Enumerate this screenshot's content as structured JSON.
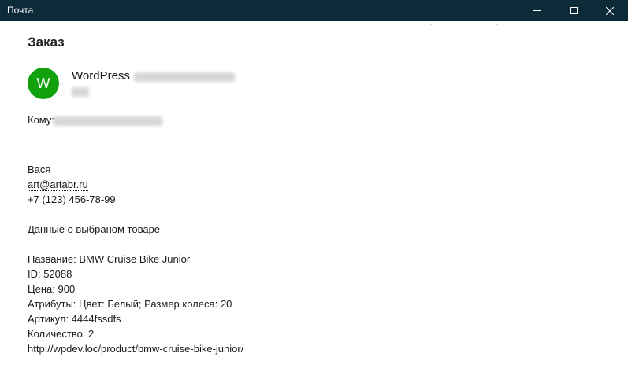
{
  "window": {
    "title": "Почта",
    "controls": [
      "minimize-icon",
      "maximize-icon",
      "close-icon"
    ]
  },
  "message": {
    "subject": "Заказ",
    "avatar_letter": "W",
    "avatar_color": "#10a10d",
    "sender_name": "WordPress",
    "to_label": "Кому:",
    "body": {
      "name": "Вася",
      "email": "art@artabr.ru",
      "phone": "+7 (123) 456-78-99",
      "product_header": "Данные о выбраном товаре",
      "separator": "——-",
      "product_name": "Название: BMW Cruise Bike Junior",
      "product_id": "ID: 52088",
      "price": "Цена: 900",
      "attributes": "Атрибуты: Цвет: Белый; Размер колеса: 20",
      "sku": "Артикул: 4444fssdfs",
      "quantity": "Количество: 2",
      "product_url": "http://wpdev.loc/product/bmw-cruise-bike-junior/"
    }
  },
  "colors": {
    "titlebar": "#0b2b39",
    "accent": "#10a10d"
  }
}
